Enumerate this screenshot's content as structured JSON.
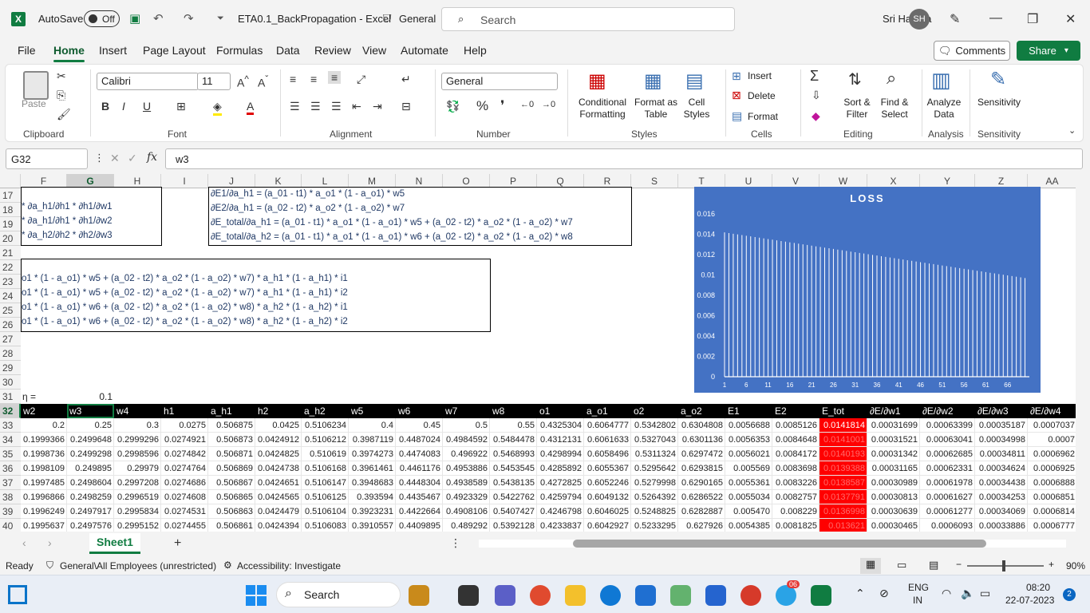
{
  "titlebar": {
    "autosave_label": "AutoSave",
    "autosave_state": "Off",
    "doc_title": "ETA0.1_BackPropagation  -  Excel",
    "sensitivity": "General",
    "search_placeholder": "Search",
    "user_name": "Sri Harsha",
    "user_initials": "SH"
  },
  "menu": {
    "items": [
      "File",
      "Home",
      "Insert",
      "Page Layout",
      "Formulas",
      "Data",
      "Review",
      "View",
      "Automate",
      "Help"
    ],
    "active": "Home",
    "comments": "Comments",
    "share": "Share"
  },
  "ribbon": {
    "paste": "Paste",
    "font_name": "Calibri",
    "font_size": "11",
    "number_format": "General",
    "conditional_formatting": "Conditional Formatting",
    "format_as_table": "Format as Table",
    "cell_styles": "Cell Styles",
    "insert": "Insert",
    "delete": "Delete",
    "format": "Format",
    "sort_filter": "Sort & Filter",
    "find_select": "Find & Select",
    "analyze_data": "Analyze Data",
    "sensitivity": "Sensitivity",
    "groups": {
      "clipboard": "Clipboard",
      "font": "Font",
      "alignment": "Alignment",
      "number": "Number",
      "styles": "Styles",
      "cells": "Cells",
      "editing": "Editing",
      "analysis": "Analysis",
      "sensitivity": "Sensitivity"
    }
  },
  "formula_bar": {
    "name_box": "G32",
    "formula": "w3"
  },
  "columns": [
    "F",
    "G",
    "H",
    "I",
    "J",
    "K",
    "L",
    "M",
    "N",
    "O",
    "P",
    "Q",
    "R",
    "S",
    "T",
    "U",
    "V",
    "W",
    "X",
    "Y",
    "Z",
    "AA"
  ],
  "rows": [
    "17",
    "18",
    "19",
    "20",
    "21",
    "22",
    "23",
    "24",
    "25",
    "26",
    "27",
    "28",
    "29",
    "30",
    "31",
    "32",
    "33",
    "34",
    "35",
    "36",
    "37",
    "38",
    "39",
    "40"
  ],
  "equations_left": [
    "* ∂a_h1/∂h1 * ∂h1/∂w1",
    "* ∂a_h1/∂h1 * ∂h1/∂w2",
    "* ∂a_h2/∂h2 * ∂h2/∂w3"
  ],
  "equations_mid": [
    "∂E1/∂a_h1 = (a_01 - t1) * a_o1 * (1 - a_o1) * w5",
    "∂E2/∂a_h1 = (a_02 - t2) * a_o2 * (1 - a_o2) * w7",
    "∂E_total/∂a_h1 = (a_01 - t1) * a_o1 * (1 - a_o1) * w5 + (a_02 - t2) * a_o2 * (1 - a_o2) * w7",
    "∂E_total/∂a_h2 = (a_01 - t1) * a_o1 * (1 - a_o1) * w6 + (a_02 - t2) * a_o2 * (1 - a_o2) * w8"
  ],
  "equations_lower": [
    "o1 * (1 - a_o1) * w5 + (a_02 - t2) * a_o2 * (1 - a_o2) * w7) * a_h1 * (1 - a_h1) * i1",
    "o1 * (1 - a_o1) * w5 + (a_02 - t2) * a_o2 * (1 - a_o2) * w7) * a_h1 * (1 - a_h1) * i2",
    "o1 * (1 - a_o1) * w6 + (a_02 - t2) * a_o2 * (1 - a_o2) * w8) * a_h2 * (1 - a_h2) * i1",
    "o1 * (1 - a_o1) * w6 + (a_02 - t2) * a_o2 * (1 - a_o2) * w8) * a_h2 * (1 - a_h2) * i2"
  ],
  "eta_label": "η =",
  "eta_value": "0.1",
  "table": {
    "headers": [
      "w2",
      "w3",
      "w4",
      "h1",
      "a_h1",
      "h2",
      "a_h2",
      "w5",
      "w6",
      "w7",
      "w8",
      "o1",
      "a_o1",
      "o2",
      "a_o2",
      "E1",
      "E2",
      "E_tot",
      "∂E/∂w1",
      "∂E/∂w2",
      "∂E/∂w3",
      "∂E/∂w4"
    ],
    "rows": [
      [
        "0.2",
        "0.25",
        "0.3",
        "0.0275",
        "0.506875",
        "0.0425",
        "0.5106234",
        "0.4",
        "0.45",
        "0.5",
        "0.55",
        "0.4325304",
        "0.6064777",
        "0.5342802",
        "0.6304808",
        "0.0056688",
        "0.0085126",
        "0.0141814",
        "0.00031699",
        "0.00063399",
        "0.00035187",
        "0.0007037"
      ],
      [
        "0.1999366",
        "0.2499648",
        "0.2999296",
        "0.0274921",
        "0.506873",
        "0.0424912",
        "0.5106212",
        "0.3987119",
        "0.4487024",
        "0.4984592",
        "0.5484478",
        "0.4312131",
        "0.6061633",
        "0.5327043",
        "0.6301136",
        "0.0056353",
        "0.0084648",
        "0.0141001",
        "0.00031521",
        "0.00063041",
        "0.00034998",
        "0.0007"
      ],
      [
        "0.1998736",
        "0.2499298",
        "0.2998596",
        "0.0274842",
        "0.506871",
        "0.0424825",
        "0.510619",
        "0.3974273",
        "0.4474083",
        "0.496922",
        "0.5468993",
        "0.4298994",
        "0.6058496",
        "0.5311324",
        "0.6297472",
        "0.0056021",
        "0.0084172",
        "0.0140193",
        "0.00031342",
        "0.00062685",
        "0.00034811",
        "0.0006962"
      ],
      [
        "0.1998109",
        "0.249895",
        "0.29979",
        "0.0274764",
        "0.506869",
        "0.0424738",
        "0.5106168",
        "0.3961461",
        "0.4461176",
        "0.4953886",
        "0.5453545",
        "0.4285892",
        "0.6055367",
        "0.5295642",
        "0.6293815",
        "0.005569",
        "0.0083698",
        "0.0139388",
        "0.00031165",
        "0.00062331",
        "0.00034624",
        "0.0006925"
      ],
      [
        "0.1997485",
        "0.2498604",
        "0.2997208",
        "0.0274686",
        "0.506867",
        "0.0424651",
        "0.5106147",
        "0.3948683",
        "0.4448304",
        "0.4938589",
        "0.5438135",
        "0.4272825",
        "0.6052246",
        "0.5279998",
        "0.6290165",
        "0.0055361",
        "0.0083226",
        "0.0138587",
        "0.00030989",
        "0.00061978",
        "0.00034438",
        "0.0006888"
      ],
      [
        "0.1996866",
        "0.2498259",
        "0.2996519",
        "0.0274608",
        "0.506865",
        "0.0424565",
        "0.5106125",
        "0.393594",
        "0.4435467",
        "0.4923329",
        "0.5422762",
        "0.4259794",
        "0.6049132",
        "0.5264392",
        "0.6286522",
        "0.0055034",
        "0.0082757",
        "0.0137791",
        "0.00030813",
        "0.00061627",
        "0.00034253",
        "0.0006851"
      ],
      [
        "0.1996249",
        "0.2497917",
        "0.2995834",
        "0.0274531",
        "0.506863",
        "0.0424479",
        "0.5106104",
        "0.3923231",
        "0.4422664",
        "0.4908106",
        "0.5407427",
        "0.4246798",
        "0.6046025",
        "0.5248825",
        "0.6282887",
        "0.005470",
        "0.008229",
        "0.0136998",
        "0.00030639",
        "0.00061277",
        "0.00034069",
        "0.0006814"
      ],
      [
        "0.1995637",
        "0.2497576",
        "0.2995152",
        "0.0274455",
        "0.506861",
        "0.0424394",
        "0.5106083",
        "0.3910557",
        "0.4409895",
        "0.489292",
        "0.5392128",
        "0.4233837",
        "0.6042927",
        "0.5233295",
        "0.627926",
        "0.0054385",
        "0.0081825",
        "0.013621",
        "0.00030465",
        "0.0006093",
        "0.00033886",
        "0.0006777"
      ]
    ]
  },
  "chart_data": {
    "type": "bar",
    "title": "LOSS",
    "categories": [
      "1",
      "6",
      "11",
      "16",
      "21",
      "26",
      "31",
      "36",
      "41",
      "46",
      "51",
      "56",
      "61",
      "66"
    ],
    "first_value": 0.0141814,
    "last_value": 0.0097,
    "num_bars": 70,
    "ylim": [
      0,
      0.016
    ],
    "yticks": [
      "0",
      "0.002",
      "0.004",
      "0.006",
      "0.008",
      "0.01",
      "0.012",
      "0.014",
      "0.016"
    ],
    "background": "#4472c4",
    "bar_color": "#ffffff"
  },
  "sheet_tab": "Sheet1",
  "status": {
    "ready": "Ready",
    "label": "General\\All Employees (unrestricted)",
    "accessibility": "Accessibility: Investigate",
    "zoom": "90%"
  },
  "taskbar": {
    "search": "Search",
    "lang_top": "ENG",
    "lang_bottom": "IN",
    "time": "08:20",
    "date": "22-07-2023",
    "notifications": "2",
    "badge": "06"
  },
  "colors": {
    "excel_green": "#107c41",
    "highlight_red": "#ff0000",
    "chart_blue": "#4472c4"
  }
}
